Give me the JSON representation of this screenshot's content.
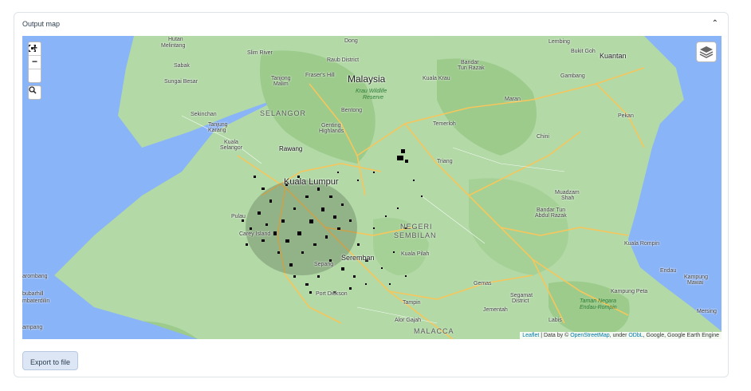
{
  "panel": {
    "title": "Output map"
  },
  "controls": {
    "zoom_in": "+",
    "zoom_out": "−"
  },
  "button": {
    "export_label": "Export to file"
  },
  "attribution": {
    "leaflet": "Leaflet",
    "sep": " | Data by © ",
    "osm": "OpenStreetMap",
    "under": ", under ",
    "odbl": "ODbL",
    "rest": ", Google, Google Earth Engine"
  },
  "labels": {
    "malaysia": "Malaysia",
    "kuala_lumpur": "Kuala Lumpur",
    "selangor": "SELANGOR",
    "negeri_l1": "NEGERI",
    "negeri_l2": "SEMBILAN",
    "malacca": "MALACCA",
    "krau_l1": "Krau Wildlife",
    "krau_l2": "Reserve",
    "taman_l1": "Taman Negara",
    "taman_l2": "Endau-Rompin",
    "kuantan": "Kuantan",
    "rawang": "Rawang",
    "seremban": "Seremban",
    "hutan": "Hutan",
    "melintang": "Melintang",
    "sabak": "Sabak",
    "sungai_besar": "Sungai Besar",
    "slim_river": "Slim River",
    "tanjong_l1": "Tanjong",
    "tanjong_l2": "Malim",
    "frasers_hill": "Fraser's Hill",
    "dong": "Dong",
    "raub_district": "Raub District",
    "kuala_krau": "Kuala Krau",
    "bandar_l1": "Bandar",
    "bandar_l2": "Tun Razak",
    "lembing": "Lembing",
    "bukit_goh": "Bukit Goh",
    "gambang": "Gambang",
    "maran": "Maran",
    "pekan": "Pekan",
    "temerloh": "Temerloh",
    "chini": "Chini",
    "triang": "Triang",
    "bentong": "Bentong",
    "genting_l1": "Genting",
    "genting_l2": "Highlands",
    "sekinchan": "Sekinchan",
    "tanjung_l1": "Tanjung",
    "tanjung_l2": "Karang",
    "kuala_sel_l1": "Kuala",
    "kuala_sel_l2": "Selangor",
    "muadzam_l1": "Muadzam",
    "muadzam_l2": "Shah",
    "bandar_tun_l1": "Bandar Tun",
    "bandar_tun_l2": "Abdul Razak",
    "kuala_rompin": "Kuala Rompin",
    "endau": "Endau",
    "kampung_l1": "Kampung",
    "kampung_l2": "Mawai",
    "kampung_peta": "Kampung Peta",
    "mersing": "Mersing",
    "port_dickson": "Port Dickson",
    "kuala_pilah": "Kuala Pilah",
    "gemas": "Gemas",
    "segamat_l1": "Segamat",
    "segamat_l2": "District",
    "jementah": "Jementah",
    "labis": "Labis",
    "tampin": "Tampin",
    "alor_gajah": "Alor Gajah",
    "sepang": "Sepang",
    "carey_island": "Carey Island",
    "pulau": "Pulau",
    "arombang": "arombang",
    "bubarhill": "bubarhill",
    "mbaterdilin": "mbaterdilin",
    "ampang": "ampang"
  },
  "colors": {
    "water": "#8ab4f8",
    "land": "#b2d9a6",
    "forest": "#9ccb8c",
    "road": "#f7c65c",
    "points": "#000000"
  }
}
